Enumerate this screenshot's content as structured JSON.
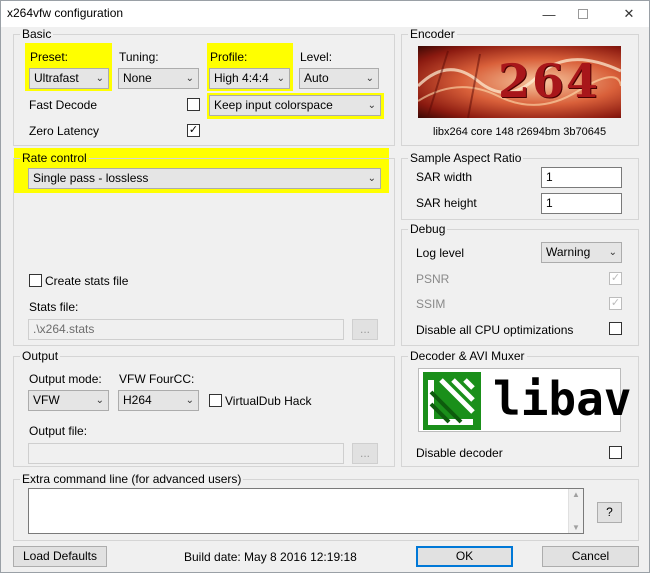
{
  "window": {
    "title": "x264vfw configuration"
  },
  "basic": {
    "group_label": "Basic",
    "preset_label": "Preset:",
    "preset_value": "Ultrafast",
    "tuning_label": "Tuning:",
    "tuning_value": "None",
    "profile_label": "Profile:",
    "profile_value": "High 4:4:4",
    "level_label": "Level:",
    "level_value": "Auto",
    "fast_decode_label": "Fast Decode",
    "fast_decode_checked": false,
    "zero_latency_label": "Zero Latency",
    "zero_latency_checked": true,
    "colorspace_value": "Keep input colorspace"
  },
  "encoder": {
    "group_label": "Encoder",
    "logo_text": "264",
    "version": "libx264 core 148 r2694bm 3b70645"
  },
  "rate_control": {
    "group_label": "Rate control",
    "mode_value": "Single pass - lossless",
    "create_stats_label": "Create stats file",
    "stats_file_label": "Stats file:",
    "stats_file_value": ".\\x264.stats",
    "browse_label": "..."
  },
  "sar": {
    "group_label": "Sample Aspect Ratio",
    "width_label": "SAR width",
    "width_value": "1",
    "height_label": "SAR height",
    "height_value": "1"
  },
  "debug": {
    "group_label": "Debug",
    "log_level_label": "Log level",
    "log_level_value": "Warning",
    "psnr_label": "PSNR",
    "ssim_label": "SSIM",
    "disable_cpu_label": "Disable all CPU optimizations"
  },
  "output": {
    "group_label": "Output",
    "mode_label": "Output mode:",
    "mode_value": "VFW",
    "fourcc_label": "VFW FourCC:",
    "fourcc_value": "H264",
    "vdub_label": "VirtualDub Hack",
    "file_label": "Output file:",
    "browse_label": "..."
  },
  "decoder": {
    "group_label": "Decoder & AVI Muxer",
    "logo_text": "libav",
    "disable_label": "Disable decoder"
  },
  "extra": {
    "group_label": "Extra command line (for advanced users)",
    "help_label": "?"
  },
  "footer": {
    "load_defaults_label": "Load Defaults",
    "build_date": "Build date: May  8 2016 12:19:18",
    "ok_label": "OK",
    "cancel_label": "Cancel"
  },
  "colors": {
    "highlight": "#ffff00",
    "accent": "#0078d7",
    "libav_green": "#1a8f1a",
    "x264_red": "#b41e14"
  }
}
